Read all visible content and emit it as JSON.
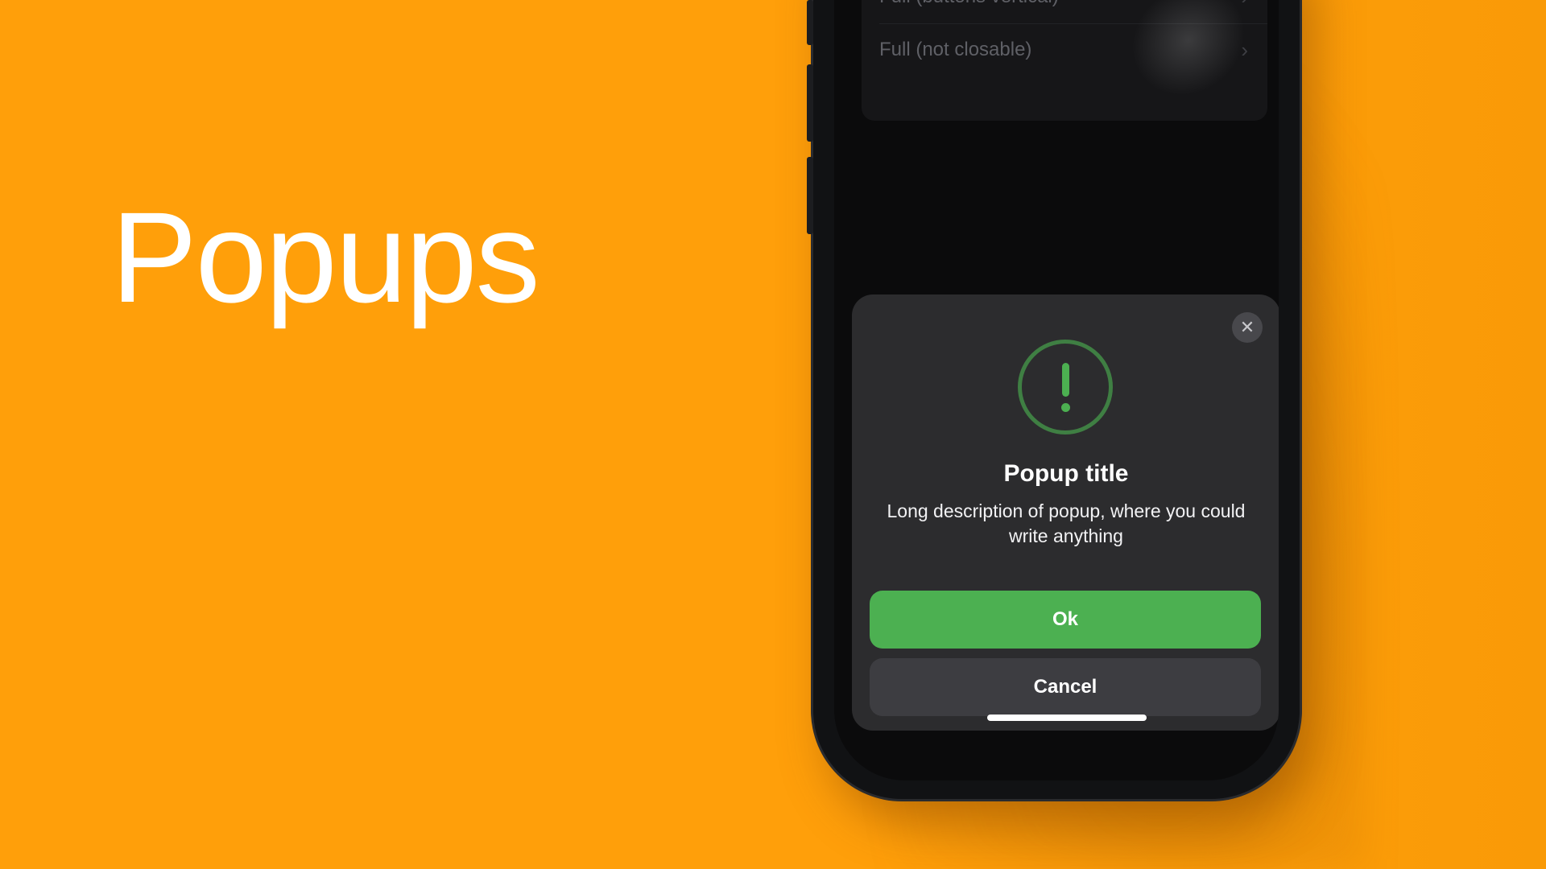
{
  "headline": "Popups",
  "background_color": "#FF9F0A",
  "list": {
    "items": [
      {
        "label": "Full (buttons vertical)",
        "icon": "chevron-right-icon"
      },
      {
        "label": "Full (not closable)",
        "icon": "chevron-right-icon"
      }
    ]
  },
  "popup": {
    "icon": "exclamation-circle-icon",
    "icon_color": "#4CB051",
    "close_icon": "close-icon",
    "title": "Popup title",
    "description": "Long description of popup, where you could write anything",
    "ok_label": "Ok",
    "cancel_label": "Cancel",
    "ok_color": "#4CB051"
  }
}
